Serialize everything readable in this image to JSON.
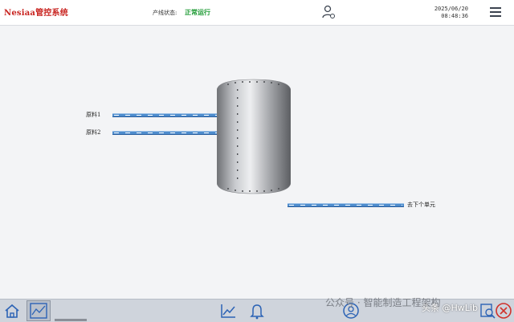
{
  "header": {
    "logo": "Nesiaa管控系统",
    "status_label": "产线状态:",
    "status_value": "正常运行",
    "date": "2025/06/20",
    "time": "08:48:36"
  },
  "process": {
    "input1_label": "原料1",
    "input2_label": "原料2",
    "output_label": "去下个单元"
  },
  "watermark": {
    "text": "公众号 · 智能制造工程架构",
    "overlay": "头条 @HwLib"
  },
  "colors": {
    "accent": "#3a6fb6",
    "status_ok": "#1d9a33",
    "logo_red": "#c8231f",
    "pipe": "#4d8ccd"
  },
  "footer": {
    "icons": [
      "home-icon",
      "process-diagram-icon",
      "trend-chart-icon",
      "alarm-bell-icon",
      "user-circle-icon",
      "search-report-icon",
      "close-circle-icon"
    ]
  }
}
